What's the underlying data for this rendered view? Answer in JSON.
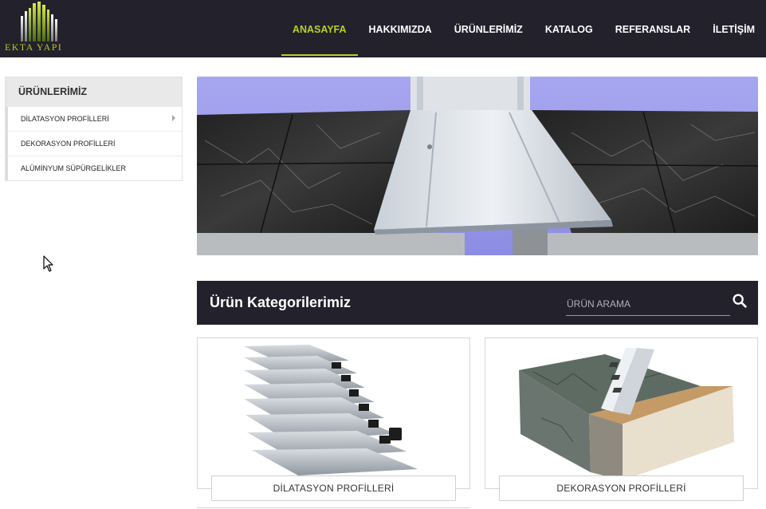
{
  "brand": {
    "logo_text": "EKTA YAPI",
    "accent_color": "#b6d12a",
    "dark_color": "#22212c"
  },
  "nav": {
    "items": [
      {
        "label": "ANASAYFA",
        "active": true
      },
      {
        "label": "HAKKIMIZDA"
      },
      {
        "label": "ÜRÜNLERİMİZ"
      },
      {
        "label": "KATALOG"
      },
      {
        "label": "REFERANSLAR"
      },
      {
        "label": "İLETİŞİM"
      }
    ]
  },
  "sidebar": {
    "title": "ÜRÜNLERİMİZ",
    "items": [
      {
        "label": "DİLATASYON PROFİLLERİ",
        "has_submenu": true
      },
      {
        "label": "DEKORASYON PROFİLLERİ"
      },
      {
        "label": "ALÜMİNYUM SÜPÜRGELİKLER"
      }
    ]
  },
  "categories": {
    "title": "Ürün Kategorilerimiz",
    "search_placeholder": "ÜRÜN ARAMA",
    "search_icon": "search-icon",
    "cards": [
      {
        "label": "DİLATASYON PROFİLLERİ"
      },
      {
        "label": "DEKORASYON PROFİLLERİ"
      }
    ]
  }
}
